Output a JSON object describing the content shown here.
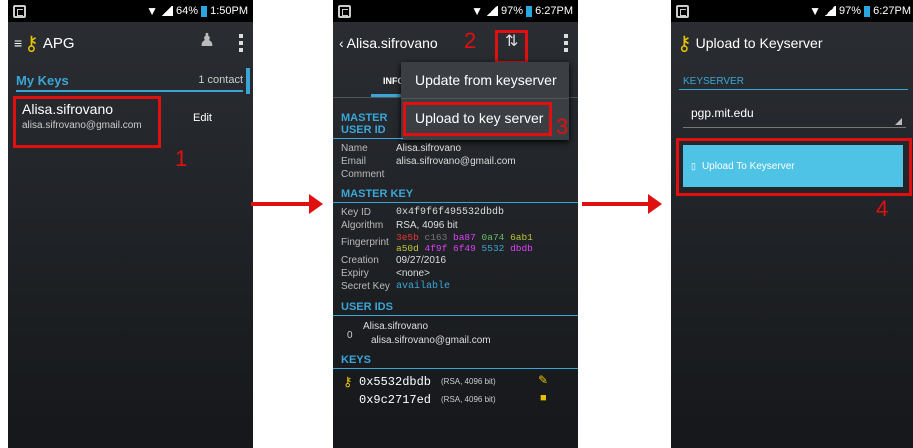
{
  "s1": {
    "status": {
      "battery": "64%",
      "time": "1:50PM"
    },
    "title": "APG",
    "section": "My Keys",
    "count": "1 contact",
    "key": {
      "name": "Alisa.sifrovano",
      "email": "alisa.sifrovano@gmail.com",
      "edit": "Edit"
    },
    "step": "1"
  },
  "s2": {
    "status": {
      "battery": "97%",
      "time": "6:27PM"
    },
    "title": "Alisa.sifrovano",
    "step2": "2",
    "step3": "3",
    "tab": "INFO",
    "menu": [
      "Update from keyserver",
      "Upload to key server"
    ],
    "master_uid_head": "MASTER USER ID",
    "rows": [
      [
        "Name",
        "Alisa.sifrovano"
      ],
      [
        "Email",
        "alisa.sifrovano@gmail.com"
      ],
      [
        "Comment",
        ""
      ]
    ],
    "master_key_head": "MASTER KEY",
    "key_id": "0x4f9f6f495532dbdb",
    "algorithm": "RSA, 4096 bit",
    "fingerprint": [
      {
        "t": "3e5b",
        "c": "#e53935"
      },
      {
        "t": "c163",
        "c": "#777777"
      },
      {
        "t": "ba87",
        "c": "#e040fb"
      },
      {
        "t": "0a74",
        "c": "#66bb6a"
      },
      {
        "t": "6ab1",
        "c": "#c0ca33"
      },
      {
        "t": "a50d",
        "c": "#c0ca33"
      },
      {
        "t": "4f9f",
        "c": "#e040fb"
      },
      {
        "t": "6f49",
        "c": "#e040fb"
      },
      {
        "t": "5532",
        "c": "#3aa6d8"
      },
      {
        "t": "dbdb",
        "c": "#e040fb"
      }
    ],
    "creation": "09/27/2016",
    "expiry": "<none>",
    "secret": "available",
    "labels": {
      "key_id": "Key ID",
      "algorithm": "Algorithm",
      "fingerprint": "Fingerprint",
      "creation": "Creation",
      "expiry": "Expiry",
      "secret": "Secret Key"
    },
    "user_ids_head": "USER IDS",
    "uid_index": "0",
    "uid_name": "Alisa.sifrovano",
    "uid_email": "alisa.sifrovano@gmail.com",
    "keys_head": "KEYS",
    "keys": [
      {
        "id": "0x5532dbdb",
        "info": "(RSA, 4096 bit)"
      },
      {
        "id": "0x9c2717ed",
        "info": "(RSA, 4096 bit)"
      }
    ]
  },
  "s3": {
    "status": {
      "battery": "97%",
      "time": "6:27PM"
    },
    "title": "Upload to Keyserver",
    "section": "KEYSERVER",
    "server": "pgp.mit.edu",
    "button": "Upload To Keyserver",
    "step": "4"
  },
  "colors": {
    "accent": "#3aa6d8",
    "annotation": "#e01010",
    "button": "#4ec3e6"
  }
}
